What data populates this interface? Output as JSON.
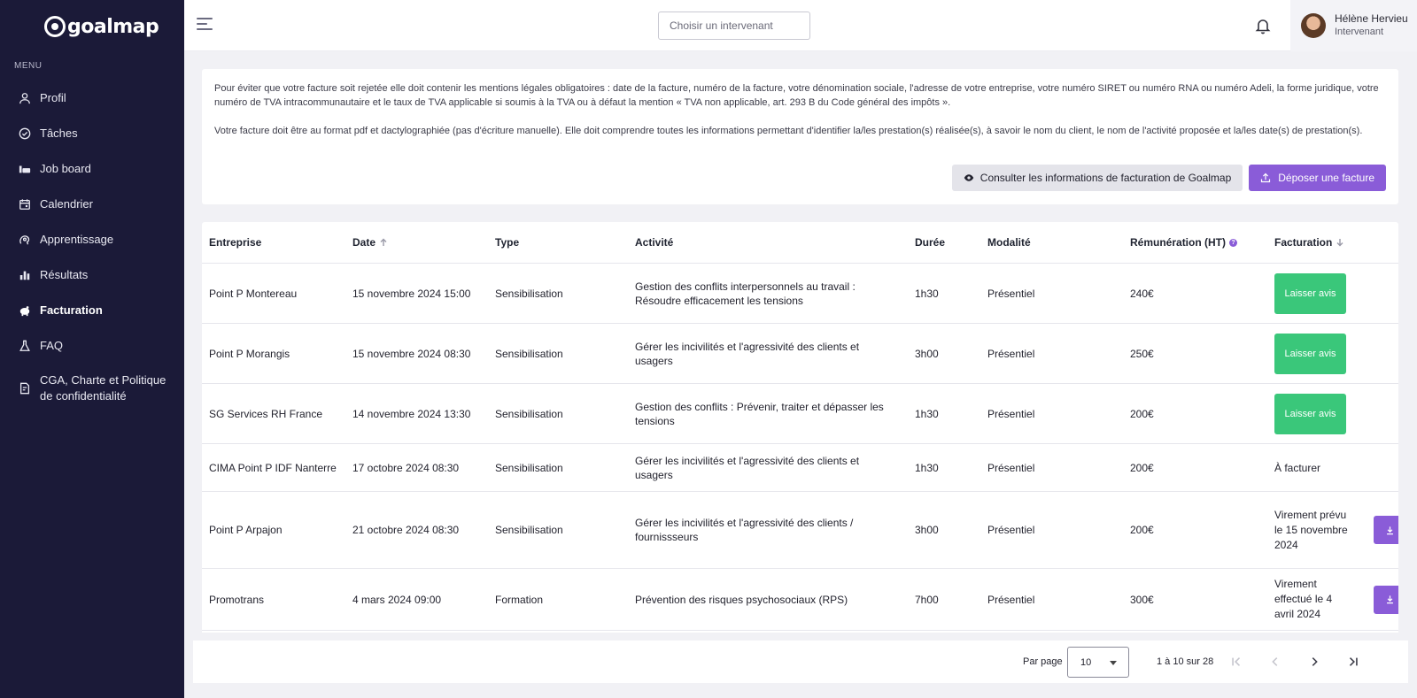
{
  "brand": {
    "name": "goalmap"
  },
  "sidebar": {
    "heading": "MENU",
    "items": [
      {
        "label": "Profil",
        "icon": "user-icon"
      },
      {
        "label": "Tâches",
        "icon": "check-circle-icon"
      },
      {
        "label": "Job board",
        "icon": "job-board-icon"
      },
      {
        "label": "Calendrier",
        "icon": "calendar-icon"
      },
      {
        "label": "Apprentissage",
        "icon": "learning-icon"
      },
      {
        "label": "Résultats",
        "icon": "bar-chart-icon"
      },
      {
        "label": "Facturation",
        "icon": "piggy-bank-icon",
        "active": true
      },
      {
        "label": "FAQ",
        "icon": "flask-icon"
      },
      {
        "label": "CGA, Charte et Politique de confidentialité",
        "icon": "document-icon"
      }
    ]
  },
  "topbar": {
    "search_placeholder": "Choisir un intervenant",
    "user": {
      "name": "Hélène Hervieu",
      "role": "Intervenant"
    }
  },
  "info": {
    "paragraph1": "Pour éviter que votre facture soit rejetée elle doit contenir les mentions légales obligatoires : date de la facture, numéro de la facture, votre dénomination sociale, l'adresse de votre entreprise, votre numéro SIRET ou numéro RNA ou numéro Adeli, la forme juridique, votre numéro de TVA intracommunautaire et le taux de TVA applicable si soumis à la TVA ou à défaut la mention « TVA non applicable, art. 293 B du Code général des impôts ».",
    "paragraph2": "Votre facture doit être au format pdf et dactylographiée (pas d'écriture manuelle). Elle doit comprendre toutes les informations permettant d'identifier la/les prestation(s) réalisée(s), à savoir le nom du client, le nom de l'activité proposée et la/les date(s) de prestation(s).",
    "consult_button": "Consulter les informations de facturation de Goalmap",
    "upload_button": "Déposer une facture"
  },
  "table": {
    "headers": {
      "entreprise": "Entreprise",
      "date": "Date",
      "type": "Type",
      "activite": "Activité",
      "duree": "Durée",
      "modalite": "Modalité",
      "remuneration": "Rémunération (HT)",
      "facturation": "Facturation"
    },
    "rows": [
      {
        "entreprise": "Point P Montereau",
        "date": "15 novembre 2024 15:00",
        "type": "Sensibilisation",
        "activite": "Gestion des conflits interpersonnels au travail : Résoudre efficacement les tensions",
        "duree": "1h30",
        "modalite": "Présentiel",
        "remuneration": "240€",
        "facturation": "Laisser avis"
      },
      {
        "entreprise": "Point P Morangis",
        "date": "15 novembre 2024 08:30",
        "type": "Sensibilisation",
        "activite": "Gérer les incivilités et l'agressivité des clients et usagers",
        "duree": "3h00",
        "modalite": "Présentiel",
        "remuneration": "250€",
        "facturation": "Laisser avis"
      },
      {
        "entreprise": "SG Services RH France",
        "date": "14 novembre 2024 13:30",
        "type": "Sensibilisation",
        "activite": "Gestion des conflits : Prévenir, traiter et dépasser les tensions",
        "duree": "1h30",
        "modalite": "Présentiel",
        "remuneration": "200€",
        "facturation": "Laisser avis"
      },
      {
        "entreprise": "CIMA Point P IDF Nanterre",
        "date": "17 octobre 2024 08:30",
        "type": "Sensibilisation",
        "activite": "Gérer les incivilités et l'agressivité des clients et usagers",
        "duree": "1h30",
        "modalite": "Présentiel",
        "remuneration": "200€",
        "facturation": "À facturer"
      },
      {
        "entreprise": "Point P Arpajon",
        "date": "21 octobre 2024 08:30",
        "type": "Sensibilisation",
        "activite": "Gérer les incivilités et l'agressivité des clients / fournissseurs",
        "duree": "3h00",
        "modalite": "Présentiel",
        "remuneration": "200€",
        "facturation": "Virement prévu le 15 novembre 2024"
      },
      {
        "entreprise": "Promotrans",
        "date": "4 mars 2024 09:00",
        "type": "Formation",
        "activite": "Prévention des risques psychosociaux (RPS)",
        "duree": "7h00",
        "modalite": "Présentiel",
        "remuneration": "300€",
        "facturation": "Virement effectué le 4 avril 2024"
      }
    ]
  },
  "pagination": {
    "per_page_label": "Par page",
    "per_page_value": "10",
    "range": "1 à 10 sur 28"
  },
  "colors": {
    "sidebar": "#1b1a38",
    "accent": "#8a5cd8",
    "success": "#3ac77a"
  }
}
